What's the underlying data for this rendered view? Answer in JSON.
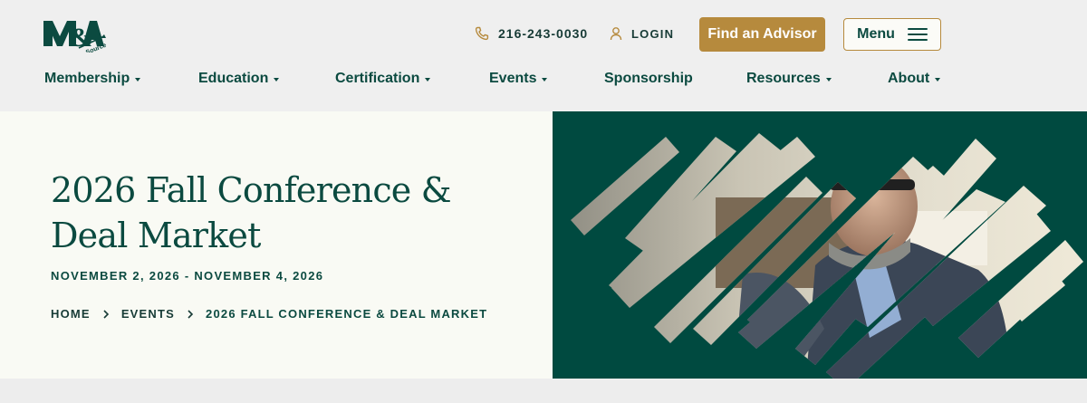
{
  "header": {
    "logo": {
      "text_main": "M&A",
      "text_sub": "Source",
      "icon": "ma-source-logo"
    },
    "phone": {
      "icon": "phone-icon",
      "label": "216-243-0030"
    },
    "login": {
      "icon": "user-icon",
      "label": "LOGIN"
    },
    "find_advisor_label": "Find an Advisor",
    "menu": {
      "label": "Menu",
      "icon": "hamburger-icon"
    }
  },
  "nav": {
    "items": [
      {
        "label": "Membership",
        "dropdown": true
      },
      {
        "label": "Education",
        "dropdown": true
      },
      {
        "label": "Certification",
        "dropdown": true
      },
      {
        "label": "Events",
        "dropdown": true
      },
      {
        "label": "Sponsorship",
        "dropdown": false
      },
      {
        "label": "Resources",
        "dropdown": true
      },
      {
        "label": "About",
        "dropdown": true
      }
    ]
  },
  "hero": {
    "title": "2026 Fall Conference & Deal Market",
    "dates": "NOVEMBER 2, 2026 - NOVEMBER 4, 2026",
    "breadcrumb": [
      {
        "label": "HOME",
        "current": false
      },
      {
        "label": "EVENTS",
        "current": false
      },
      {
        "label": "2026 FALL CONFERENCE & DEAL MARKET",
        "current": true
      }
    ],
    "image": "man-with-glasses-in-suit-striped-photo"
  },
  "colors": {
    "brand_green": "#0b4a40",
    "panel_green": "#004a40",
    "gold": "#b68a3d",
    "hero_bg": "#f9faf4",
    "header_bg": "#efefef"
  }
}
